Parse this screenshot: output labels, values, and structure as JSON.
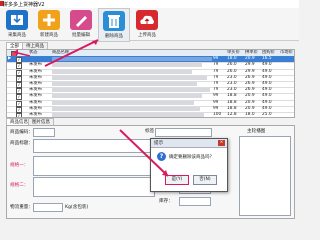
{
  "window": {
    "title": "拼多多上货神器V2"
  },
  "toolbar": {
    "buttons": [
      {
        "label": "采集商品",
        "icon": "import-icon",
        "color": "#1e73c8"
      },
      {
        "label": "新建商品",
        "icon": "add-icon",
        "color": "#f0a21a"
      },
      {
        "label": "批量编辑",
        "icon": "pencil-icon",
        "color": "#d64b8b"
      },
      {
        "label": "删除商品",
        "icon": "trash-icon",
        "color": "#2a8fd6"
      },
      {
        "label": "上传商品",
        "icon": "cloud-upload-icon",
        "color": "#d8282f"
      }
    ]
  },
  "list_tabs": [
    "全部",
    "待上商品"
  ],
  "grid": {
    "headers": [
      "",
      "",
      "状态",
      "商品名称",
      "",
      "",
      "单买价",
      "拼单价",
      "团购价",
      "市场价"
    ],
    "rows": [
      {
        "status": "",
        "qty": "99",
        "price1": "18.0",
        "price2": "20.9",
        "price3": "16.5",
        "selected": true
      },
      {
        "status": "未发布",
        "qty": "79",
        "price1": "26.0",
        "price2": "29.9",
        "price3": "49.0",
        "selected": false
      },
      {
        "status": "未发布",
        "qty": "79",
        "price1": "26.0",
        "price2": "29.9",
        "price3": "49.0",
        "selected": false
      },
      {
        "status": "未发布",
        "qty": "79",
        "price1": "23.0",
        "price2": "26.9",
        "price3": "49.0",
        "selected": false
      },
      {
        "status": "未发布",
        "qty": "79",
        "price1": "23.0",
        "price2": "26.9",
        "price3": "49.0",
        "selected": false
      },
      {
        "status": "未发布",
        "qty": "79",
        "price1": "23.0",
        "price2": "26.9",
        "price3": "49.0",
        "selected": false
      },
      {
        "status": "未发布",
        "qty": "99",
        "price1": "18.8",
        "price2": "20.9",
        "price3": "49.0",
        "selected": false
      },
      {
        "status": "未发布",
        "qty": "99",
        "price1": "18.8",
        "price2": "20.9",
        "price3": "49.0",
        "selected": false
      },
      {
        "status": "未发布",
        "qty": "99",
        "price1": "18.8",
        "price2": "20.9",
        "price3": "49.0",
        "selected": false
      },
      {
        "status": "未发布",
        "qty": "100",
        "price1": "12.8",
        "price2": "18.0",
        "price3": "25.0",
        "selected": false
      }
    ]
  },
  "detail_tabs": [
    "商品信息",
    "图片信息"
  ],
  "detail": {
    "label_tag": "标签",
    "label_goods_code": "商品编码：",
    "label_goods_title": "商品标题：",
    "label_spec1": "规格一：",
    "label_spec2": "规格二：",
    "label_weight": "物流重量：",
    "weight_unit": "Kg(含包装)",
    "label_single_price": "单买价：",
    "label_group_price": "团购价：",
    "label_market": "市场价：",
    "label_stock": "库存：",
    "label_main_image": "主轮播图"
  },
  "dialog": {
    "title": "提示",
    "message": "确定要删除该商品吗？",
    "ok": "是(Y)",
    "cancel": "否(N)"
  },
  "annotation_color": "#d81b60"
}
